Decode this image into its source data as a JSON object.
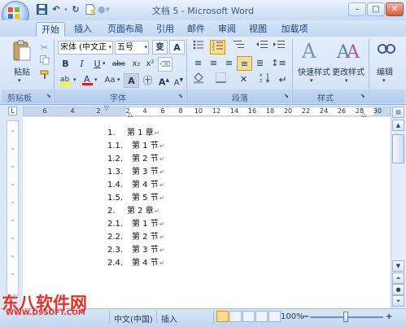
{
  "title_bar": {
    "title": "文档 5 - Microsoft Word",
    "quick_access": [
      "save-icon",
      "undo-icon",
      "redo-icon",
      "new-document-icon",
      "customize-icon"
    ],
    "window_buttons": {
      "minimize": "–",
      "maximize": "□",
      "close": "✕"
    }
  },
  "tabs": [
    {
      "label": "开始",
      "active": true
    },
    {
      "label": "插入"
    },
    {
      "label": "页面布局"
    },
    {
      "label": "引用"
    },
    {
      "label": "邮件"
    },
    {
      "label": "审阅"
    },
    {
      "label": "视图"
    },
    {
      "label": "加载项"
    }
  ],
  "ribbon": {
    "clipboard": {
      "label": "剪贴板",
      "paste_label": "粘贴"
    },
    "font": {
      "label": "字体",
      "font_name": "宋体 (中文正",
      "font_size": "五号",
      "bold": "B",
      "italic": "I",
      "underline": "U",
      "strike": "abc",
      "subscript": "x₂",
      "superscript": "x²",
      "font_color": "A",
      "grow": "A",
      "shrink": "A",
      "change_case": "Aa",
      "highlight": "ab",
      "char_shading": "A"
    },
    "paragraph": {
      "label": "段落"
    },
    "styles": {
      "label": "样式",
      "quick_styles_label": "快速样式",
      "change_styles_label": "更改样式"
    },
    "editing": {
      "label": "编辑"
    }
  },
  "ruler": {
    "numbers": [
      "6",
      "4",
      "2",
      "2",
      "4",
      "6",
      "8",
      "10",
      "12",
      "14",
      "16",
      "18",
      "20",
      "22",
      "24",
      "26",
      "28",
      "30"
    ]
  },
  "document": {
    "lines": [
      {
        "num": "1.",
        "text": "第 1 章",
        "level": 1
      },
      {
        "num": "1.1.",
        "text": "第 1 节",
        "level": 2
      },
      {
        "num": "1.2.",
        "text": "第 2 节",
        "level": 2
      },
      {
        "num": "1.3.",
        "text": "第 3 节",
        "level": 2
      },
      {
        "num": "1.4.",
        "text": "第 4 节",
        "level": 2
      },
      {
        "num": "1.5.",
        "text": "第 5 节",
        "level": 2
      },
      {
        "num": "2.",
        "text": "第 2 章",
        "level": 1
      },
      {
        "num": "2.1.",
        "text": "第 1 节",
        "level": 2
      },
      {
        "num": "2.2.",
        "text": "第 2 节",
        "level": 2
      },
      {
        "num": "2.3.",
        "text": "第 3 节",
        "level": 2
      },
      {
        "num": "2.4.",
        "text": "第 4 节",
        "level": 2
      }
    ],
    "paragraph_mark": "↵"
  },
  "status_bar": {
    "language": "中文(中国)",
    "insert_mode": "插入",
    "zoom": "100%",
    "zoom_minus": "−",
    "zoom_plus": "+"
  },
  "watermark": {
    "line1": "东八软件网",
    "line2": "WWW.D9SOFT.COM"
  }
}
